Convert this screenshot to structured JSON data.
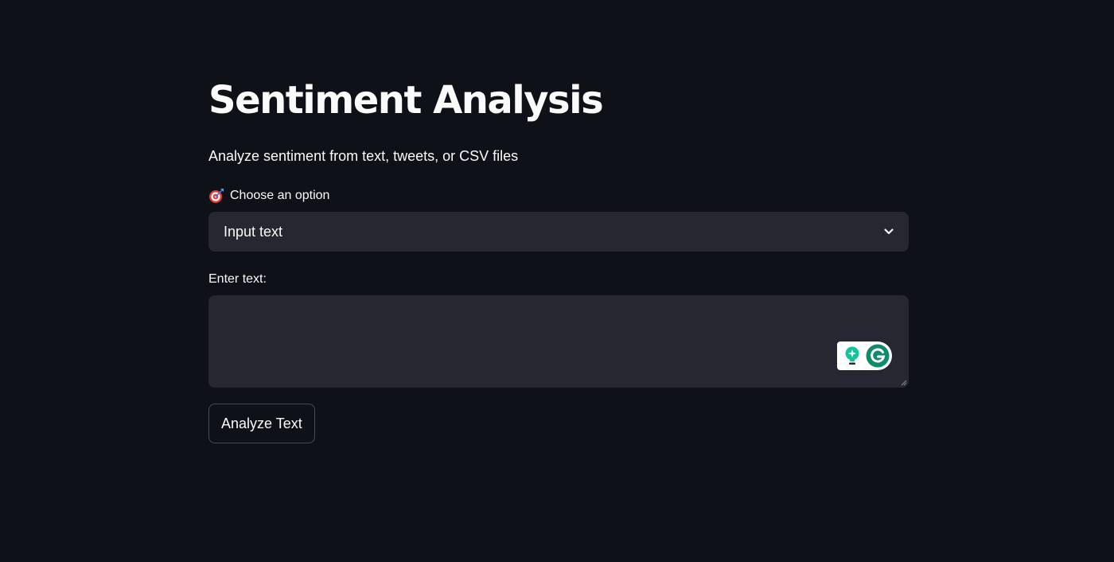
{
  "header": {
    "title": "Sentiment Analysis",
    "subtitle": "Analyze sentiment from text, tweets, or CSV files"
  },
  "option_select": {
    "label": "Choose an option",
    "label_icon": "target-icon",
    "selected_value": "Input text",
    "dropdown_icon": "chevron-down-icon"
  },
  "text_input": {
    "label": "Enter text:",
    "value": "",
    "extension_icons": [
      "grammarly-lightbulb-icon",
      "grammarly-logo-icon"
    ]
  },
  "actions": {
    "analyze_label": "Analyze Text"
  },
  "colors": {
    "background": "#0e1117",
    "input_background": "#262730",
    "text": "#fafafa",
    "grammarly_green": "#15c39a",
    "grammarly_dark": "#0e8a6c"
  }
}
